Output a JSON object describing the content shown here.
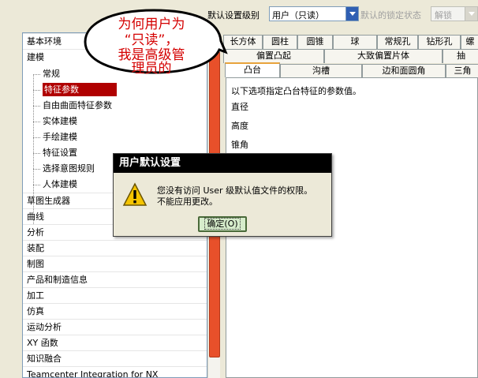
{
  "toolbar": {
    "level_label": "默认设置级别",
    "level_value": "用户（只读）",
    "lock_label": "默认的锁定状态",
    "lock_value": "解锁"
  },
  "callout": {
    "line1": "为何用户为",
    "line2": "“只读”，",
    "line3": "我是高级管",
    "line4": "理员的"
  },
  "tree": {
    "items": [
      {
        "label": "基本环境"
      },
      {
        "label": "建模"
      },
      {
        "label": "常规"
      },
      {
        "label": "特征参数"
      },
      {
        "label": "自由曲面特征参数"
      },
      {
        "label": "实体建模"
      },
      {
        "label": "手绘建模"
      },
      {
        "label": "特征设置"
      },
      {
        "label": "选择意图规则"
      },
      {
        "label": "人体建模"
      },
      {
        "label": "草图生成器"
      },
      {
        "label": "曲线"
      },
      {
        "label": "分析"
      },
      {
        "label": "装配"
      },
      {
        "label": "制图"
      },
      {
        "label": "产品和制造信息"
      },
      {
        "label": "加工"
      },
      {
        "label": "仿真"
      },
      {
        "label": "运动分析"
      },
      {
        "label": "XY 函数"
      },
      {
        "label": "知识融合"
      },
      {
        "label": "Teamcenter Integration for NX"
      }
    ]
  },
  "tabs": {
    "row1": [
      "长方体",
      "圆柱",
      "圆锥",
      "球",
      "常规孔",
      "钻形孔",
      "螺"
    ],
    "row2": [
      "偏置凸起",
      "大致偏置片体",
      "抽"
    ],
    "row3": [
      "凸台",
      "沟槽",
      "边和面圆角",
      "三角"
    ]
  },
  "panel": {
    "description": "以下选项指定凸台特征的参数值。",
    "fields": [
      "直径",
      "高度",
      "锥角"
    ]
  },
  "dialog": {
    "title": "用户默认设置",
    "message_line1": "您没有访问 User 级默认值文件的权限。",
    "message_line2": "不能应用更改。",
    "ok_label": "确定(O)"
  }
}
